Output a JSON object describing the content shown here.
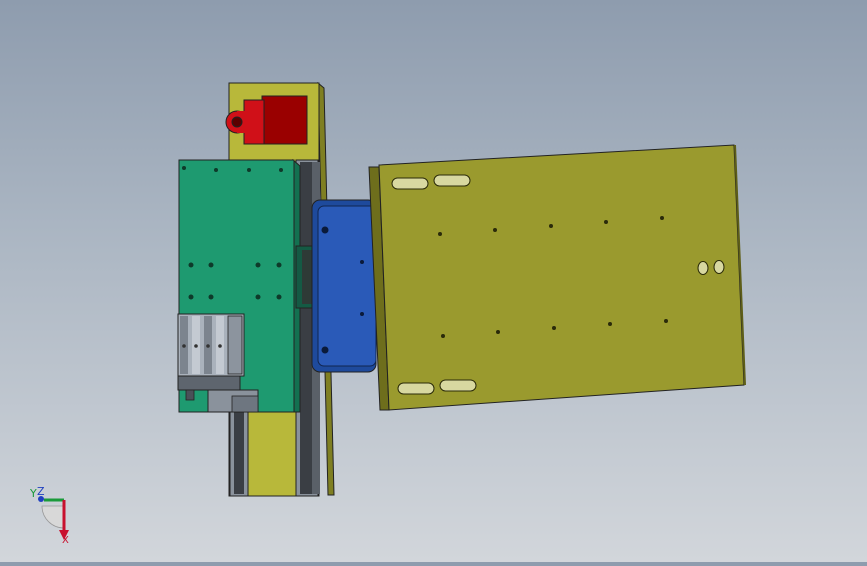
{
  "view": {
    "background_top": "#8e9cae",
    "background_bottom": "#d2d6db"
  },
  "triad": {
    "y_label": "Y",
    "z_label": "Z",
    "x_label": "X",
    "x_color": "#c8102e",
    "y_color": "#1a9a3a",
    "z_color": "#2040c0"
  },
  "parts": {
    "base_plate_color": "#9a9a2e",
    "column_color": "#b8b83a",
    "carriage_color": "#1e9a70",
    "motor_mount_color": "#2a5ab8",
    "clamp_color": "#c0101a",
    "gripper_color": "#9aa2ac"
  }
}
